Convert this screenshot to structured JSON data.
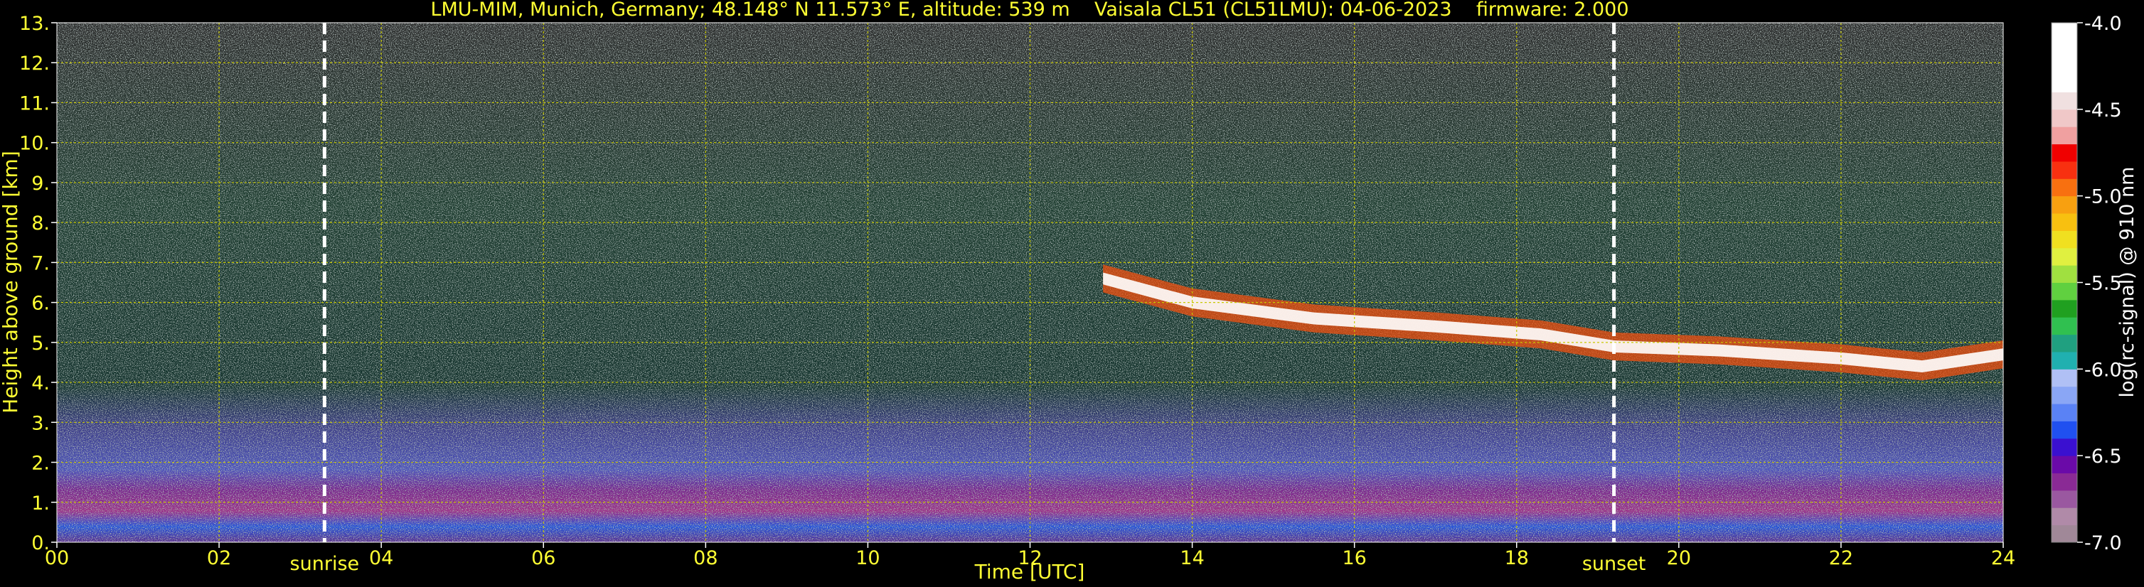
{
  "chart_data": {
    "type": "heatmap",
    "title": "LMU-MIM, Munich, Germany; 48.148° N 11.573° E, altitude: 539 m    Vaisala CL51 (CL51LMU): 04-06-2023    firmware: 2.000",
    "xlabel": "Time [UTC]",
    "ylabel": "Height above ground [km]",
    "xlim": [
      0,
      24
    ],
    "ylim": [
      0,
      13
    ],
    "x_ticks": [
      "00",
      "02",
      "04",
      "06",
      "08",
      "10",
      "12",
      "14",
      "16",
      "18",
      "20",
      "22",
      "24"
    ],
    "y_ticks": [
      "0.",
      "1.",
      "2.",
      "3.",
      "4.",
      "5.",
      "6.",
      "7.",
      "8.",
      "9.",
      "10.",
      "11.",
      "12.",
      "13."
    ],
    "grid": true,
    "events": [
      {
        "label": "sunrise",
        "time": 3.3
      },
      {
        "label": "sunset",
        "time": 19.2
      }
    ],
    "colorbar": {
      "label": "log(rc-signal) @ 910 nm",
      "range": [
        -7.0,
        -4.0
      ],
      "ticks": [
        "-4.0",
        "-4.5",
        "-5.0",
        "-5.5",
        "-6.0",
        "-6.5",
        "-7.0"
      ],
      "tick_values": [
        -4.0,
        -4.5,
        -5.0,
        -5.5,
        -6.0,
        -6.5,
        -7.0
      ],
      "colors": [
        "#a08898",
        "#b08aa8",
        "#9a58a0",
        "#8a2a95",
        "#6a0aa8",
        "#3a10d0",
        "#2050f0",
        "#5a82f5",
        "#8aa6f5",
        "#b0c0f5",
        "#20b0b0",
        "#20a080",
        "#30c050",
        "#20a020",
        "#60d040",
        "#a0e040",
        "#e0f040",
        "#f0e020",
        "#f8c010",
        "#f8a010",
        "#f87010",
        "#f83010",
        "#f00000",
        "#f0a0a0",
        "#f0c8c8",
        "#f0e0e0",
        "#ffffff",
        "#ffffff",
        "#ffffff",
        "#ffffff"
      ]
    },
    "cloud_layer": {
      "description_points": [
        {
          "time": 12.9,
          "height_km": 6.6
        },
        {
          "time": 14.0,
          "height_km": 6.0
        },
        {
          "time": 15.5,
          "height_km": 5.6
        },
        {
          "time": 17.0,
          "height_km": 5.4
        },
        {
          "time": 18.3,
          "height_km": 5.2
        },
        {
          "time": 19.2,
          "height_km": 4.9
        },
        {
          "time": 20.5,
          "height_km": 4.8
        },
        {
          "time": 22.0,
          "height_km": 4.6
        },
        {
          "time": 23.0,
          "height_km": 4.4
        },
        {
          "time": 24.0,
          "height_km": 4.7
        }
      ]
    }
  }
}
